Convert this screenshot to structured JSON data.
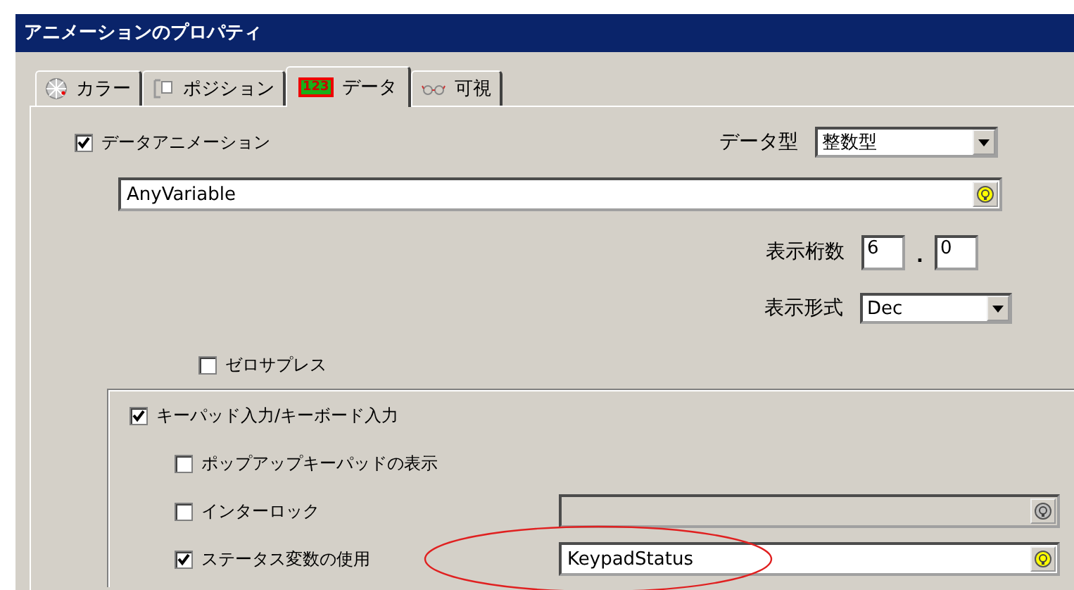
{
  "window": {
    "title": "アニメーションのプロパティ"
  },
  "tabs": [
    {
      "label": "カラー",
      "kind": "wheel",
      "selected": false
    },
    {
      "label": "ポジション",
      "kind": "position",
      "selected": false
    },
    {
      "label": "データ",
      "kind": "digits",
      "icon_text": "123",
      "selected": true
    },
    {
      "label": "可視",
      "kind": "glasses",
      "selected": false
    }
  ],
  "data_animation": {
    "label": "データアニメーション",
    "checked": true
  },
  "data_type": {
    "label": "データ型",
    "value": "整数型"
  },
  "variable": {
    "value": "AnyVariable",
    "disabled": false
  },
  "digits": {
    "label": "表示桁数",
    "integer": "6",
    "separator": ".",
    "decimal": "0"
  },
  "format": {
    "label": "表示形式",
    "value": "Dec"
  },
  "zero_suppress": {
    "label": "ゼロサプレス",
    "checked": false
  },
  "keypad": {
    "label": "キーパッド入力/キーボード入力",
    "checked": true,
    "options": [
      {
        "label": "ポップアップキーパッドの表示",
        "checked": false
      },
      {
        "label": "インターロック",
        "checked": false,
        "field": {
          "disabled": true
        }
      },
      {
        "label": "ステータス変数の使用",
        "checked": true,
        "field": {
          "value": "KeypadStatus",
          "disabled": false
        },
        "highlighted": true
      }
    ]
  }
}
